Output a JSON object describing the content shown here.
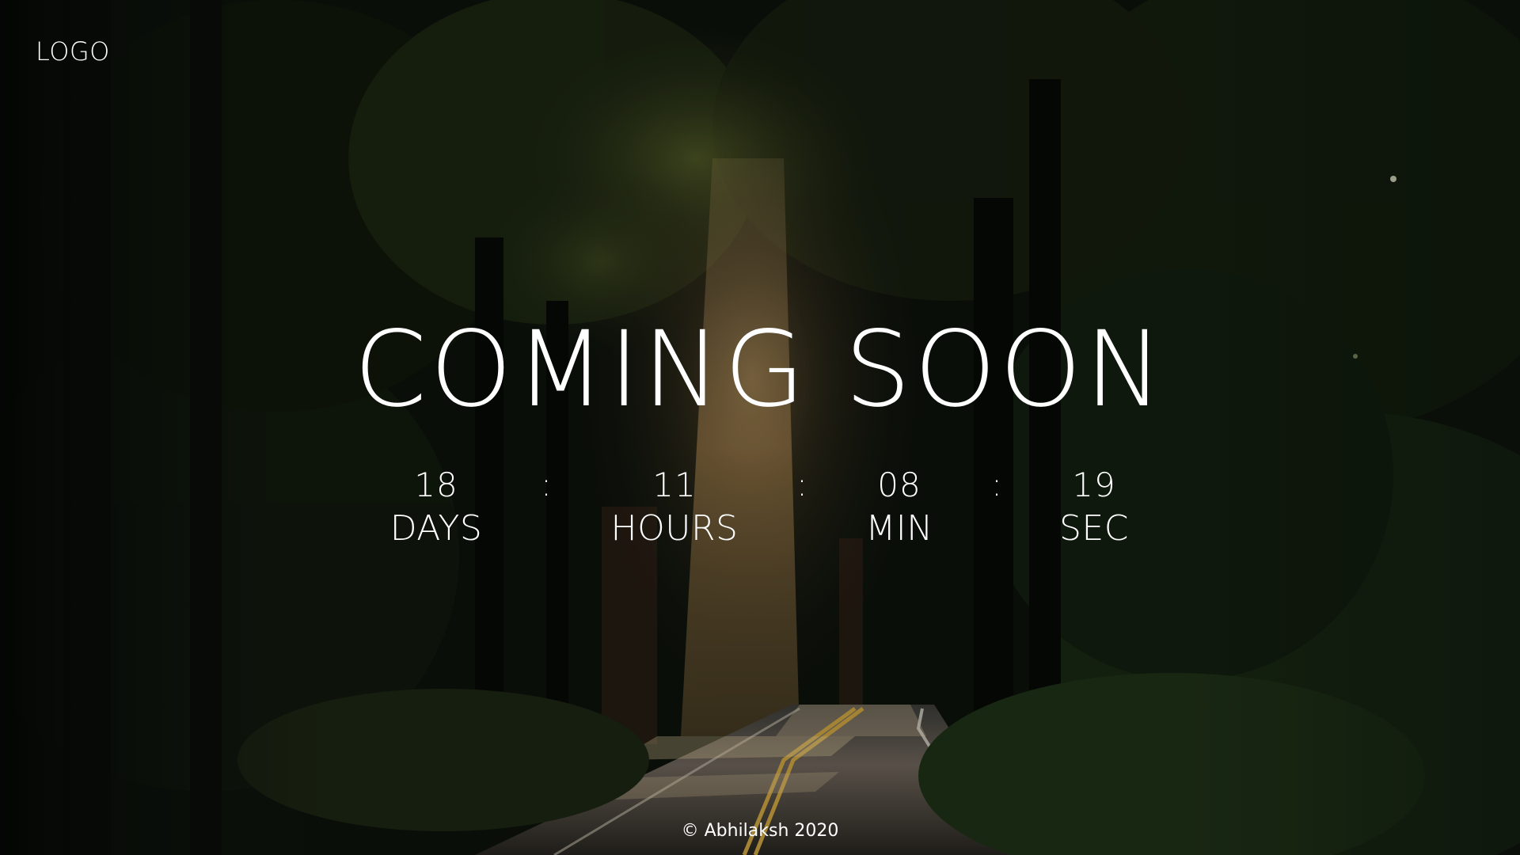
{
  "header": {
    "logo_text": "LOGO"
  },
  "main": {
    "headline": "COMING SOON",
    "countdown": {
      "days": {
        "value": "18",
        "label": "DAYS"
      },
      "hours": {
        "value": "11",
        "label": "HOURS"
      },
      "minutes": {
        "value": "08",
        "label": "MIN"
      },
      "seconds": {
        "value": "19",
        "label": "SEC"
      },
      "separator": ":"
    }
  },
  "footer": {
    "copyright": "© Abhilaksh 2020"
  },
  "colors": {
    "text": "#ffffff",
    "forest_dark": "#0b0f0a",
    "light_beam": "#b8955a",
    "road": "#2a2826"
  },
  "background": {
    "icon": "forest-road-photo"
  }
}
